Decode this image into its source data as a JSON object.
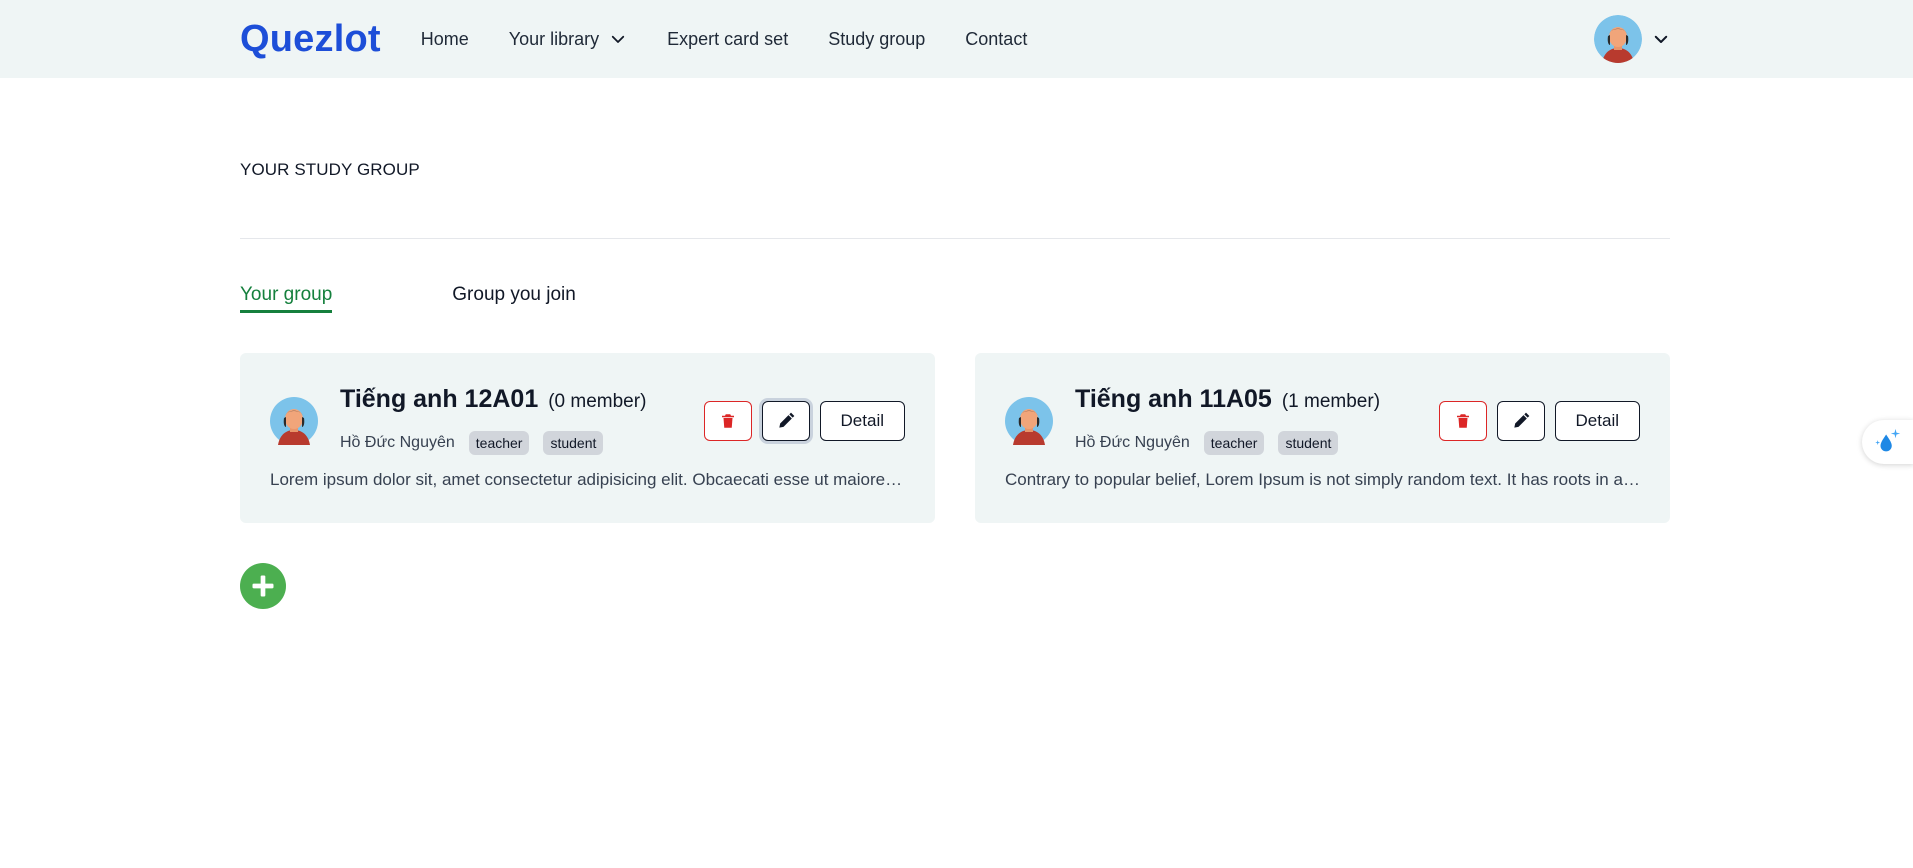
{
  "app": {
    "logo": "Quezlot"
  },
  "nav": {
    "items": [
      {
        "label": "Home"
      },
      {
        "label": "Your library",
        "has_dropdown": true
      },
      {
        "label": "Expert card set"
      },
      {
        "label": "Study group"
      },
      {
        "label": "Contact"
      }
    ]
  },
  "page": {
    "title": "YOUR STUDY GROUP"
  },
  "tabs": [
    {
      "label": "Your group",
      "active": true
    },
    {
      "label": "Group you join",
      "active": false
    }
  ],
  "groups": [
    {
      "name": "Tiếng anh 12A01",
      "member_count": "(0 member)",
      "owner": "Hồ Đức Nguyên",
      "roles": [
        "teacher",
        "student"
      ],
      "description": "Lorem ipsum dolor sit, amet consectetur adipisicing elit. Obcaecati esse ut maiores voluptatem",
      "detail_label": "Detail"
    },
    {
      "name": "Tiếng anh 11A05",
      "member_count": "(1 member)",
      "owner": "Hồ Đức Nguyên",
      "roles": [
        "teacher",
        "student"
      ],
      "description": "Contrary to popular belief, Lorem Ipsum is not simply random text. It has roots in a piece",
      "detail_label": "Detail"
    }
  ],
  "icons": {
    "user_menu": "avatar",
    "dropdown": "chevron-down-icon",
    "delete": "trash-icon",
    "edit": "pencil-icon",
    "add": "plus-icon",
    "widget": "water-drop-sparkle-icon"
  },
  "colors": {
    "brand": "#1d4ed8",
    "active_tab": "#15803d",
    "delete": "#dc2626",
    "add": "#4caf50",
    "card_bg": "#eff5f5"
  }
}
